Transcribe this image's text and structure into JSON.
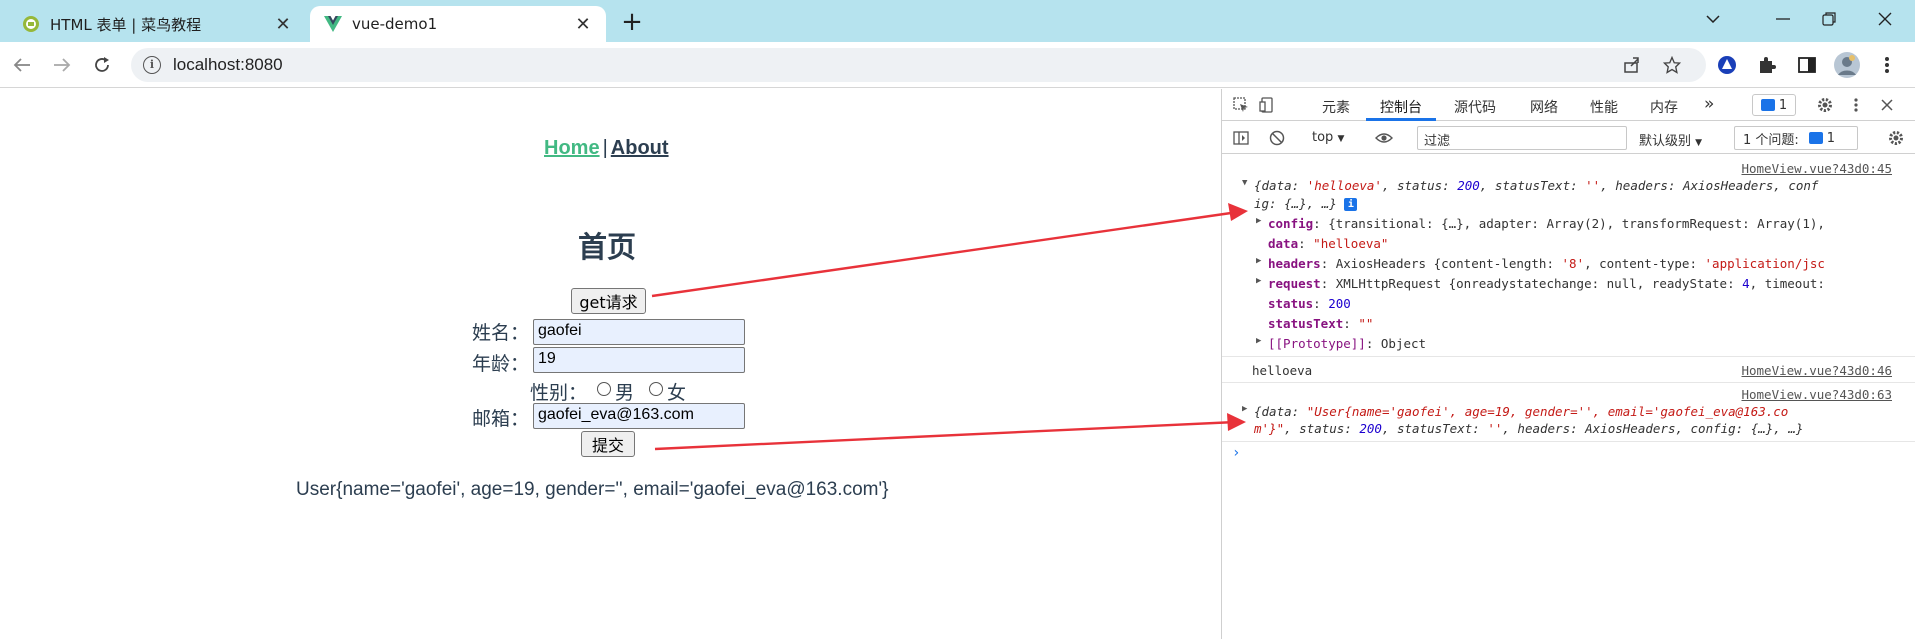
{
  "tabs": [
    {
      "title": "HTML 表单 | 菜鸟教程",
      "active": false
    },
    {
      "title": "vue-demo1",
      "active": true
    }
  ],
  "toolbar": {
    "url": "localhost:8080"
  },
  "page": {
    "nav": {
      "home": "Home",
      "separator": "|",
      "about": "About"
    },
    "heading": "首页",
    "get_button": "get请求",
    "form": {
      "name_label": "姓名：",
      "name_value": "gaofei",
      "age_label": "年龄：",
      "age_value": "19",
      "gender_label": "性别：",
      "gender_male": "男",
      "gender_female": "女",
      "email_label": "邮箱：",
      "email_value": "gaofei_eva@163.com",
      "submit": "提交"
    },
    "result": "User{name='gaofei', age=19, gender='', email='gaofei_eva@163.com'}"
  },
  "devtools": {
    "tabs": [
      "元素",
      "控制台",
      "源代码",
      "网络",
      "性能",
      "内存"
    ],
    "active_tab": "控制台",
    "more": "»",
    "issue_count": "1",
    "context": "top",
    "filter_placeholder": "过滤",
    "level": "默认级别",
    "issues_label": "1 个问题:",
    "issues_count": "1",
    "console": {
      "entry1": {
        "source": "HomeView.vue?43d0:45",
        "summary_a": "{data: ",
        "summary_data": "'helloeva'",
        "summary_b": ", status: ",
        "summary_status": "200",
        "summary_c": ", statusText: ",
        "summary_st": "''",
        "summary_d": ", headers: AxiosHeaders, conf",
        "summary_wrap": "ig: {…}, …}",
        "config_key": "config",
        "config_val": ": {transitional: {…}, adapter: Array(2), transformRequest: Array(1),",
        "data_key": "data",
        "data_val": "\"helloeva\"",
        "headers_key": "headers",
        "headers_val_a": ": AxiosHeaders {content-length: ",
        "headers_len": "'8'",
        "headers_val_b": ", content-type: ",
        "headers_ct": "'application/jsc",
        "request_key": "request",
        "request_val_a": ": XMLHttpRequest {onreadystatechange: null, readyState: ",
        "request_rs": "4",
        "request_val_b": ", timeout:",
        "status_key": "status",
        "status_val": "200",
        "statustext_key": "statusText",
        "statustext_val": "\"\"",
        "proto_key": "[[Prototype]]",
        "proto_val": ": Object"
      },
      "entry2": {
        "text": "helloeva",
        "source": "HomeView.vue?43d0:46"
      },
      "entry3": {
        "source": "HomeView.vue?43d0:63",
        "line1_a": "{data: ",
        "line1_str": "\"User{name='gaofei', age=19, gender='', email='gaofei_eva@163.co",
        "line2_str": "m'}\"",
        "line2_a": ", status: ",
        "line2_status": "200",
        "line2_b": ", statusText: ",
        "line2_st": "''",
        "line2_c": ", headers: AxiosHeaders, config: {…}, …}"
      },
      "prompt": "›"
    }
  },
  "colors": {
    "tabstrip": "#b6e3ee",
    "vue_green": "#42b983",
    "vue_text": "#2c3e50",
    "devtools_accent": "#1a73e8",
    "annotation_arrow": "#e8323a"
  },
  "icons": [
    "runoob-favicon",
    "vue-favicon",
    "close-icon",
    "plus-icon",
    "chevron-down-icon",
    "minimize-icon",
    "restore-icon",
    "back-icon",
    "forward-icon",
    "reload-icon",
    "info-icon",
    "share-icon",
    "star-icon",
    "extension-icon",
    "puzzle-icon",
    "sidebar-icon",
    "avatar",
    "menu-icon",
    "inspect-icon",
    "device-icon",
    "settings-icon",
    "clear-icon",
    "eye-icon",
    "sidebar-toggle-icon"
  ]
}
